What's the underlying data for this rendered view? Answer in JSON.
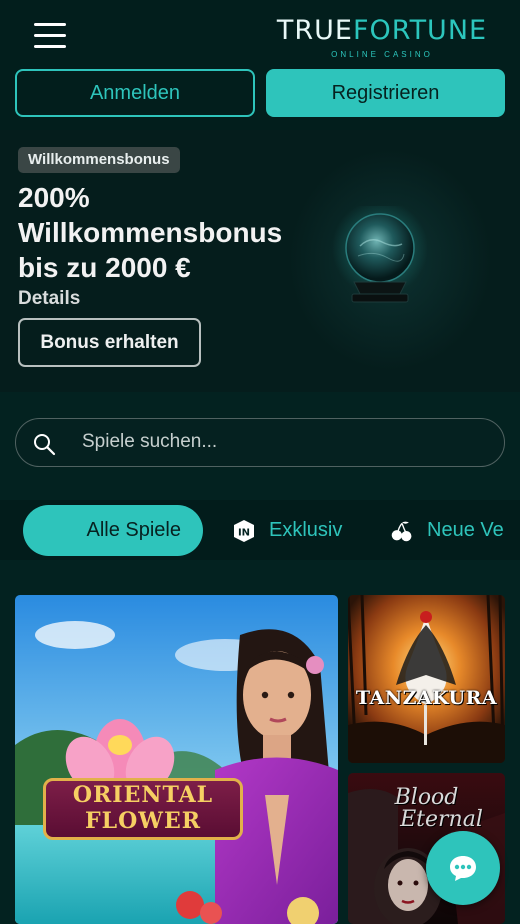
{
  "header": {
    "logo_main_part1": "TRUE",
    "logo_main_part2": "FORTUNE",
    "logo_sub": "ONLINE CASINO",
    "login_label": "Anmelden",
    "register_label": "Registrieren"
  },
  "promo": {
    "badge": "Willkommensbonus",
    "title_line1": "200%",
    "title_line2": "Willkommensbonus",
    "title_line3": "bis zu 2000 €",
    "details_label": "Details",
    "cta_label": "Bonus erhalten"
  },
  "search": {
    "placeholder": "Spiele suchen..."
  },
  "tabs": {
    "all": "Alle Spiele",
    "exclusive": "Exklusiv",
    "new": "Neue Ve"
  },
  "games": [
    {
      "title_line1": "ORIENTAL",
      "title_line2": "FLOWER"
    },
    {
      "title": "TANZAKURA"
    },
    {
      "title_line1": "Blood",
      "title_line2": "Eternal"
    }
  ],
  "colors": {
    "accent": "#2ec4bb",
    "background": "#032220"
  },
  "icons": {
    "menu": "hamburger-menu-icon",
    "search": "search-icon",
    "exclusive": "exclusive-in-icon",
    "new": "cherries-icon",
    "chat": "chat-icon"
  }
}
